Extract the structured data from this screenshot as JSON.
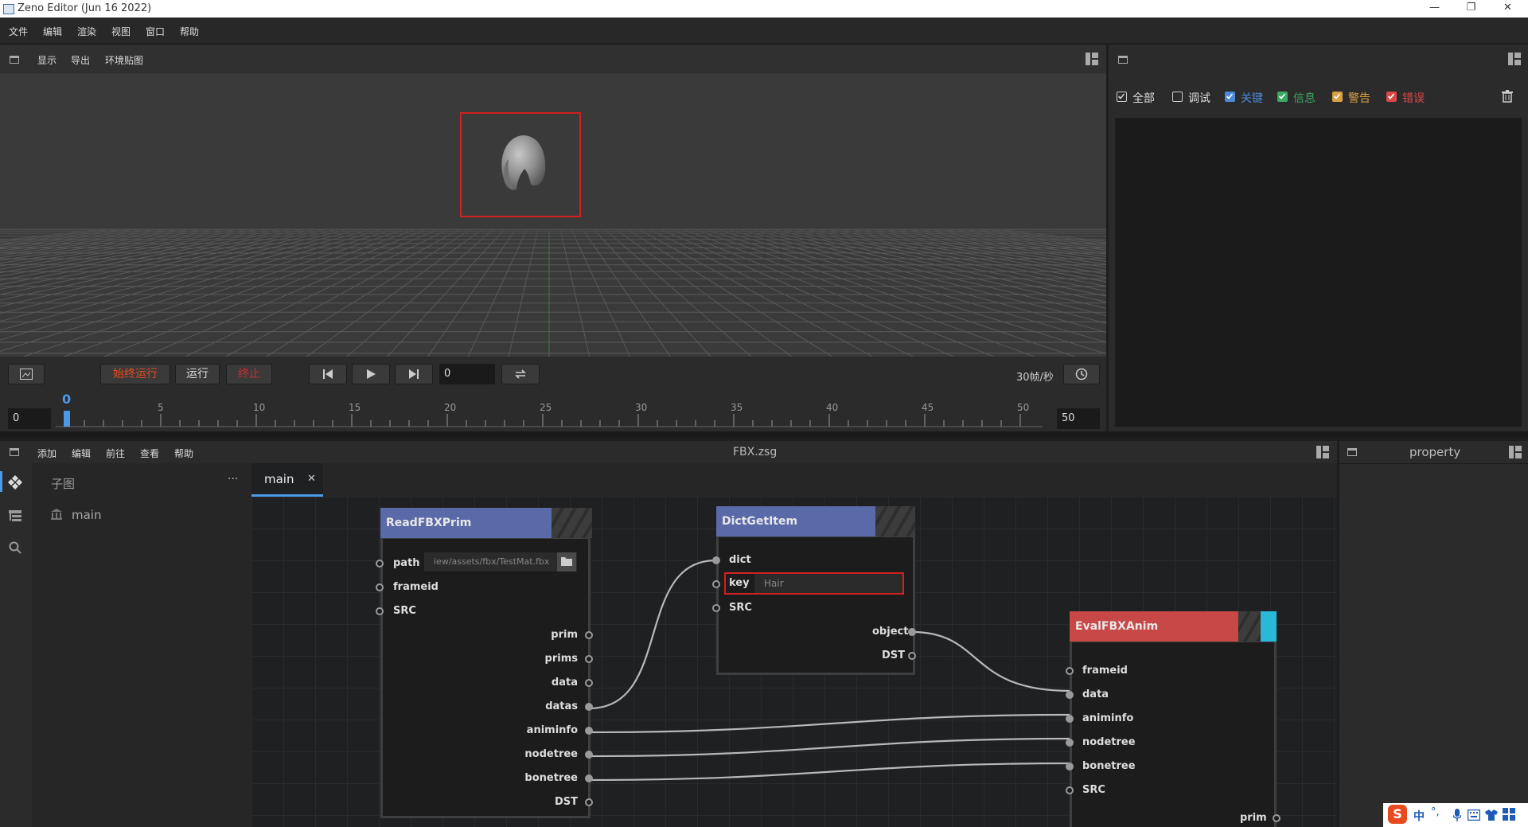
{
  "window": {
    "title": "Zeno Editor (Jun 16 2022)"
  },
  "menubar": {
    "items": [
      "文件",
      "编辑",
      "渲染",
      "视图",
      "窗口",
      "帮助"
    ]
  },
  "viewport_toolbar": {
    "items": [
      "显示",
      "导出",
      "环境贴图"
    ]
  },
  "controls": {
    "always_run": "始终运行",
    "run": "运行",
    "stop": "终止",
    "frame_value": "0",
    "fps": "30帧/秒"
  },
  "timeline": {
    "start": "0",
    "end": "50",
    "current_label": "0",
    "ticks": [
      "5",
      "10",
      "15",
      "20",
      "25",
      "30",
      "35",
      "40",
      "45",
      "50"
    ]
  },
  "log_panel": {
    "filters": [
      {
        "label": "全部",
        "checked": true,
        "color": "#dddddd"
      },
      {
        "label": "调试",
        "checked": false,
        "color": "#dddddd"
      },
      {
        "label": "关键",
        "checked": true,
        "color": "#4a8ad8"
      },
      {
        "label": "信息",
        "checked": true,
        "color": "#3aa860"
      },
      {
        "label": "警告",
        "checked": true,
        "color": "#d8a040"
      },
      {
        "label": "错误",
        "checked": true,
        "color": "#d84848"
      }
    ]
  },
  "graph_menubar": {
    "items": [
      "添加",
      "编辑",
      "前往",
      "查看",
      "帮助"
    ],
    "file_title": "FBX.zsg"
  },
  "subgraph_panel": {
    "title": "子图",
    "more": "···",
    "items": [
      "main"
    ]
  },
  "tabs": [
    {
      "label": "main",
      "close": "✕"
    }
  ],
  "property_panel": {
    "title": "property"
  },
  "nodes": {
    "read": {
      "title": "ReadFBXPrim",
      "inputs": [
        "path",
        "frameid",
        "SRC"
      ],
      "path_value": "iew/assets/fbx/TestMat.fbx",
      "outputs": [
        "prim",
        "prims",
        "data",
        "datas",
        "animinfo",
        "nodetree",
        "bonetree",
        "DST"
      ]
    },
    "dict": {
      "title": "DictGetItem",
      "inputs": [
        "dict",
        "key",
        "SRC"
      ],
      "key_value": "Hair",
      "outputs": [
        "object",
        "DST"
      ]
    },
    "eval": {
      "title": "EvalFBXAnim",
      "inputs": [
        "frameid",
        "data",
        "animinfo",
        "nodetree",
        "bonetree",
        "SRC"
      ],
      "outputs": [
        "prim"
      ]
    }
  },
  "tray": {
    "ime": "中",
    "punct": "°,"
  }
}
